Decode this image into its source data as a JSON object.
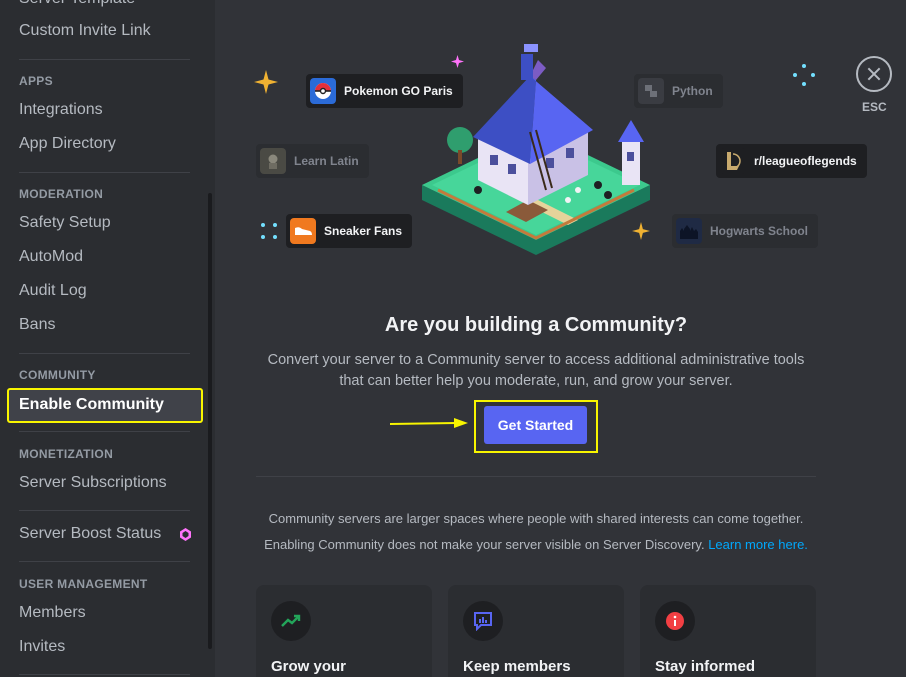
{
  "sidebar": {
    "partial_top": "Server Template",
    "invite_link": "Custom Invite Link",
    "sections": {
      "apps": "APPS",
      "moderation": "MODERATION",
      "community": "COMMUNITY",
      "monetization": "MONETIZATION",
      "user_management": "USER MANAGEMENT"
    },
    "items": {
      "integrations": "Integrations",
      "app_directory": "App Directory",
      "safety_setup": "Safety Setup",
      "automod": "AutoMod",
      "audit_log": "Audit Log",
      "bans": "Bans",
      "enable_community": "Enable Community",
      "server_subscriptions": "Server Subscriptions",
      "server_boost_status": "Server Boost Status",
      "members": "Members",
      "invites": "Invites"
    }
  },
  "header": {
    "esc_label": "ESC"
  },
  "hero": {
    "chips": {
      "pokemon": "Pokemon GO Paris",
      "python": "Python",
      "latin": "Learn Latin",
      "league": "r/leagueoflegends",
      "sneaker": "Sneaker Fans",
      "hogwarts": "Hogwarts School"
    }
  },
  "main": {
    "title": "Are you building a Community?",
    "description": "Convert your server to a Community server to access additional administrative tools that can better help you moderate, run, and grow your server.",
    "button": "Get Started",
    "info_line1": "Community servers are larger spaces where people with shared interests can come together.",
    "info_line2": "Enabling Community does not make your server visible on Server Discovery.",
    "learn_more": "Learn more here.",
    "cards": [
      {
        "title": "Grow your"
      },
      {
        "title": "Keep members"
      },
      {
        "title": "Stay informed"
      }
    ]
  },
  "colors": {
    "accent": "#5865f2",
    "highlight": "#f8f500",
    "link": "#00a8fc"
  }
}
